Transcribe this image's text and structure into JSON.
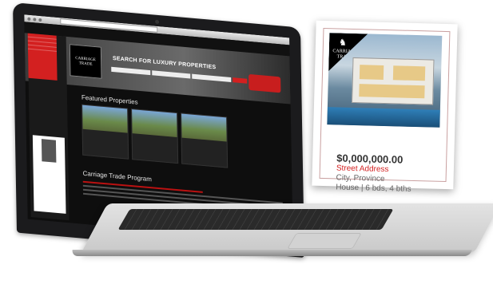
{
  "screen": {
    "search_title": "SEARCH FOR LUXURY PROPERTIES",
    "logo_text": "CARRIAGE TRADE",
    "featured_title": "Featured Properties",
    "program_title": "Carriage Trade Program"
  },
  "flyer": {
    "logo_text": "CARRIAGE TRADE",
    "price": "$0,000,000.00",
    "street": "Street Address",
    "city": "City, Province",
    "info": "House | 6 bds, 4 bths"
  },
  "colors": {
    "accent": "#d32020",
    "laptop_body": "#1b1b1d",
    "base": "#d6d6d6"
  }
}
